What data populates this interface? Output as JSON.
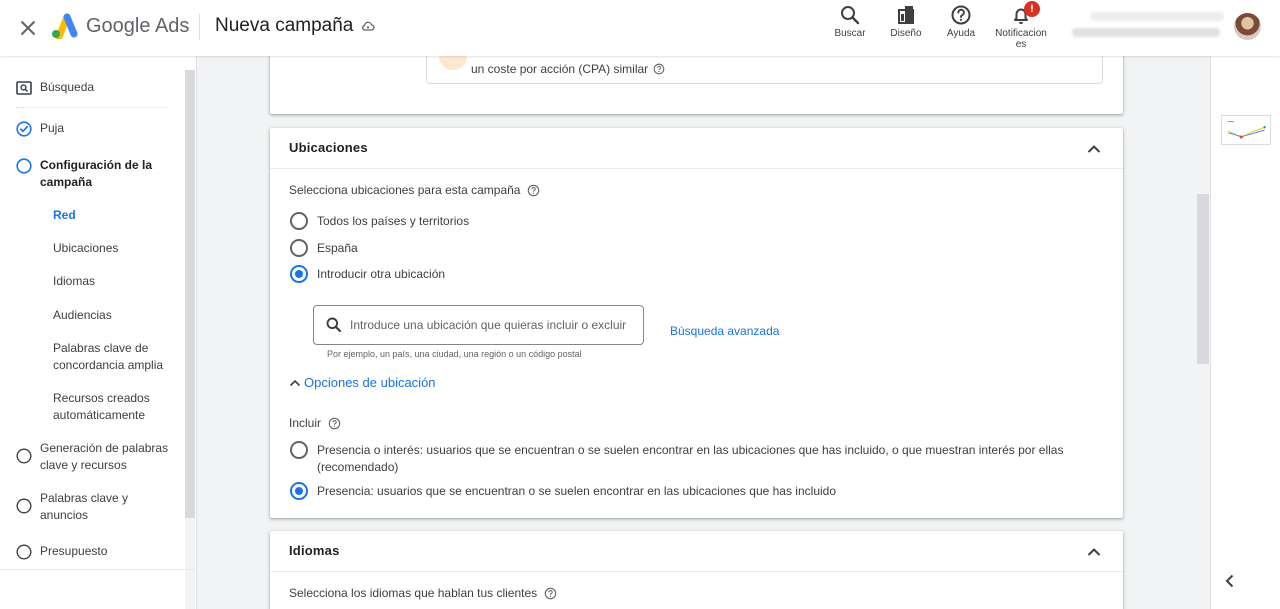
{
  "header": {
    "brand": "Google Ads",
    "campaign_title": "Nueva campaña",
    "tools": {
      "search": "Buscar",
      "design": "Diseño",
      "help": "Ayuda",
      "notifications_l1": "Notificacion",
      "notifications_l2": "es"
    },
    "notification_badge": "!",
    "account": {
      "name": "",
      "email": ""
    }
  },
  "sidebar": {
    "items": [
      {
        "label": "Búsqueda",
        "state": "search-icon"
      },
      {
        "label": "Puja",
        "state": "complete"
      },
      {
        "label": "Configuración de la campaña",
        "state": "current"
      },
      {
        "label": "Generación de palabras clave y recursos",
        "state": "pending"
      },
      {
        "label": "Palabras clave y anuncios",
        "state": "pending"
      },
      {
        "label": "Presupuesto",
        "state": "pending"
      }
    ],
    "subitems": [
      {
        "label": "Red",
        "active": true
      },
      {
        "label": "Ubicaciones",
        "active": false
      },
      {
        "label": "Idiomas",
        "active": false
      },
      {
        "label": "Audiencias",
        "active": false
      },
      {
        "label": "Palabras clave de concordancia amplia",
        "active": false
      },
      {
        "label": "Recursos creados automáticamente",
        "active": false
      }
    ]
  },
  "bid_strategy": {
    "partial_text": "un coste por acción (CPA) similar"
  },
  "locations": {
    "title": "Ubicaciones",
    "prompt": "Selecciona ubicaciones para esta campaña",
    "options": [
      {
        "label": "Todos los países y territorios",
        "checked": false
      },
      {
        "label": "España",
        "checked": false
      },
      {
        "label": "Introducir otra ubicación",
        "checked": true
      }
    ],
    "search_placeholder": "Introduce una ubicación que quieras incluir o excluir",
    "search_value": "",
    "hint": "Por ejemplo, un país, una ciudad, una región o un código postal",
    "advanced_search": "Búsqueda avanzada",
    "options_toggle": "Opciones de ubicación",
    "include_label": "Incluir",
    "include_options": [
      {
        "label": "Presencia o interés: usuarios que se encuentran o se suelen encontrar en las ubicaciones que has incluido, o que muestran interés por ellas (recomendado)",
        "checked": false
      },
      {
        "label": "Presencia: usuarios que se encuentran o se suelen encontrar en las ubicaciones que has incluido",
        "checked": true
      }
    ]
  },
  "languages": {
    "title": "Idiomas",
    "prompt": "Selecciona los idiomas que hablan tus clientes"
  },
  "colors": {
    "accent": "#1a73e8",
    "text": "#3c4043",
    "alert": "#d93025"
  }
}
